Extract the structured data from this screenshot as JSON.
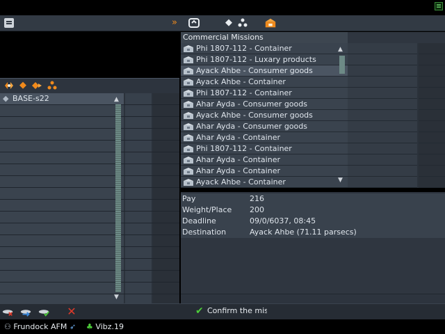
{
  "left_panel": {
    "base_name": "BASE-s22"
  },
  "missions": {
    "title": "Commercial Missions",
    "items": [
      {
        "label": "Phi 1807-112 - Container"
      },
      {
        "label": "Phi 1807-112 - Luxary products"
      },
      {
        "label": "Ayack Ahbe - Consumer goods"
      },
      {
        "label": "Ayack Ahbe - Container"
      },
      {
        "label": "Phi 1807-112 - Container"
      },
      {
        "label": "Ahar Ayda - Consumer goods"
      },
      {
        "label": "Ayack Ahbe - Consumer goods"
      },
      {
        "label": "Ahar Ayda - Consumer goods"
      },
      {
        "label": "Ahar Ayda - Container"
      },
      {
        "label": "Phi 1807-112 - Container"
      },
      {
        "label": "Ahar Ayda - Container"
      },
      {
        "label": "Ahar Ayda - Container"
      },
      {
        "label": "Ayack Ahbe - Container"
      }
    ],
    "selected_index": 2
  },
  "details": {
    "pay_label": "Pay",
    "pay_value": "216",
    "weight_label": "Weight/Place",
    "weight_value": "200",
    "deadline_label": "Deadline",
    "deadline_value": "09/0/6037, 08:45",
    "destination_label": "Destination",
    "destination_value": "Ayack Ahbe (71.11 parsecs)"
  },
  "bottom": {
    "confirm_label": "Confirm the missio"
  },
  "status": {
    "player": "Frundock AFM",
    "credits": "Vibz.19"
  },
  "colors": {
    "accent": "#f08a1c",
    "confirm": "#4ecf3a",
    "cancel": "#e03a2a"
  }
}
